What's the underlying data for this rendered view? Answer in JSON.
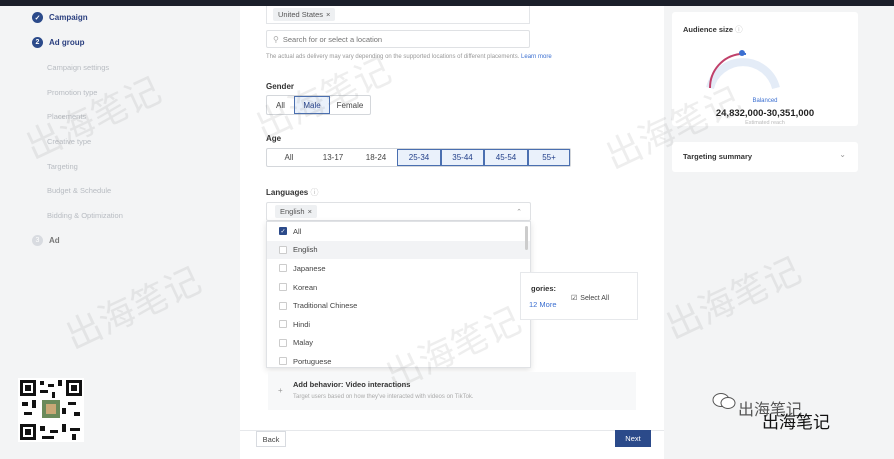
{
  "steps": [
    {
      "label": "Campaign",
      "state": "done"
    },
    {
      "label": "Ad group",
      "state": "current",
      "number": "2"
    },
    {
      "label": "Ad",
      "state": "pending",
      "number": "3"
    }
  ],
  "substeps": [
    "Campaign settings",
    "Promotion type",
    "Placements",
    "Creative type",
    "Targeting",
    "Budget & Schedule",
    "Bidding & Optimization"
  ],
  "location": {
    "chip": "United States",
    "search_placeholder": "Search for or select a location",
    "note": "The actual ads delivery may vary depending on the supported locations of different placements.",
    "learn_more": "Learn more"
  },
  "gender": {
    "label": "Gender",
    "options": [
      "All",
      "Male",
      "Female"
    ],
    "selected": "Male"
  },
  "age": {
    "label": "Age",
    "options": [
      "All",
      "13-17",
      "18-24",
      "25-34",
      "35-44",
      "45-54",
      "55+"
    ],
    "selected": [
      "25-34",
      "35-44",
      "45-54",
      "55+"
    ]
  },
  "languages": {
    "label": "Languages",
    "chip": "English",
    "options": [
      {
        "label": "All",
        "checked": true
      },
      {
        "label": "English",
        "checked": false
      },
      {
        "label": "Japanese",
        "checked": false
      },
      {
        "label": "Korean",
        "checked": false
      },
      {
        "label": "Traditional Chinese",
        "checked": false
      },
      {
        "label": "Hindi",
        "checked": false
      },
      {
        "label": "Malay",
        "checked": false
      },
      {
        "label": "Portuguese",
        "checked": false
      }
    ]
  },
  "behind": {
    "categories": "gories:",
    "more": "12 More",
    "select_all": "Select All"
  },
  "behavior": {
    "title": "Add behavior: Video interactions",
    "desc": "Target users based on how they've interacted with videos on TikTok."
  },
  "footer": {
    "back": "Back",
    "next": "Next"
  },
  "audience": {
    "title": "Audience size",
    "level": "Balanced",
    "range": "24,832,000-30,351,000",
    "note": "Estimated reach"
  },
  "summary": {
    "title": "Targeting summary"
  },
  "watermark": {
    "text": "出海笔记",
    "brand": "出海笔记"
  }
}
